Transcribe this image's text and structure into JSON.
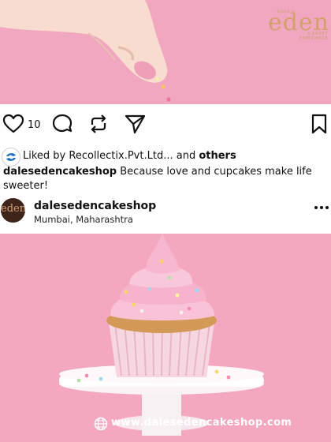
{
  "brand": {
    "logo_word": "eden",
    "logo_small": "DALE'S",
    "logo_tag": "A SWEET EXPERIENCE"
  },
  "post": {
    "like_count": "10",
    "liked_by_prefix": "Liked by",
    "liked_by_user": "Recollectix.Pvt.Ltd...",
    "liked_by_and": "and",
    "liked_by_others": "others",
    "caption_user": "dalesedencakeshop",
    "caption_text": "Because love and cupcakes make life sweeter!",
    "owner_avatar_text": "eden",
    "owner_name": "dalesedencakeshop",
    "owner_location": "Mumbai, Maharashtra"
  },
  "footer": {
    "website": "www.dalesedencakeshop.com"
  },
  "icons": {
    "like": "heart-icon",
    "comment": "comment-icon",
    "repost": "repost-icon",
    "share": "send-icon",
    "save": "bookmark-icon",
    "more": "more-horizontal-icon",
    "globe": "globe-icon",
    "liked_avatar": "recollectix-logo"
  },
  "colors": {
    "background_pink": "#f3a9c1",
    "card_white": "#ffffff",
    "logo_gold": "#d3a06f",
    "owner_avatar_bg": "#3e2419",
    "text": "#111111"
  }
}
